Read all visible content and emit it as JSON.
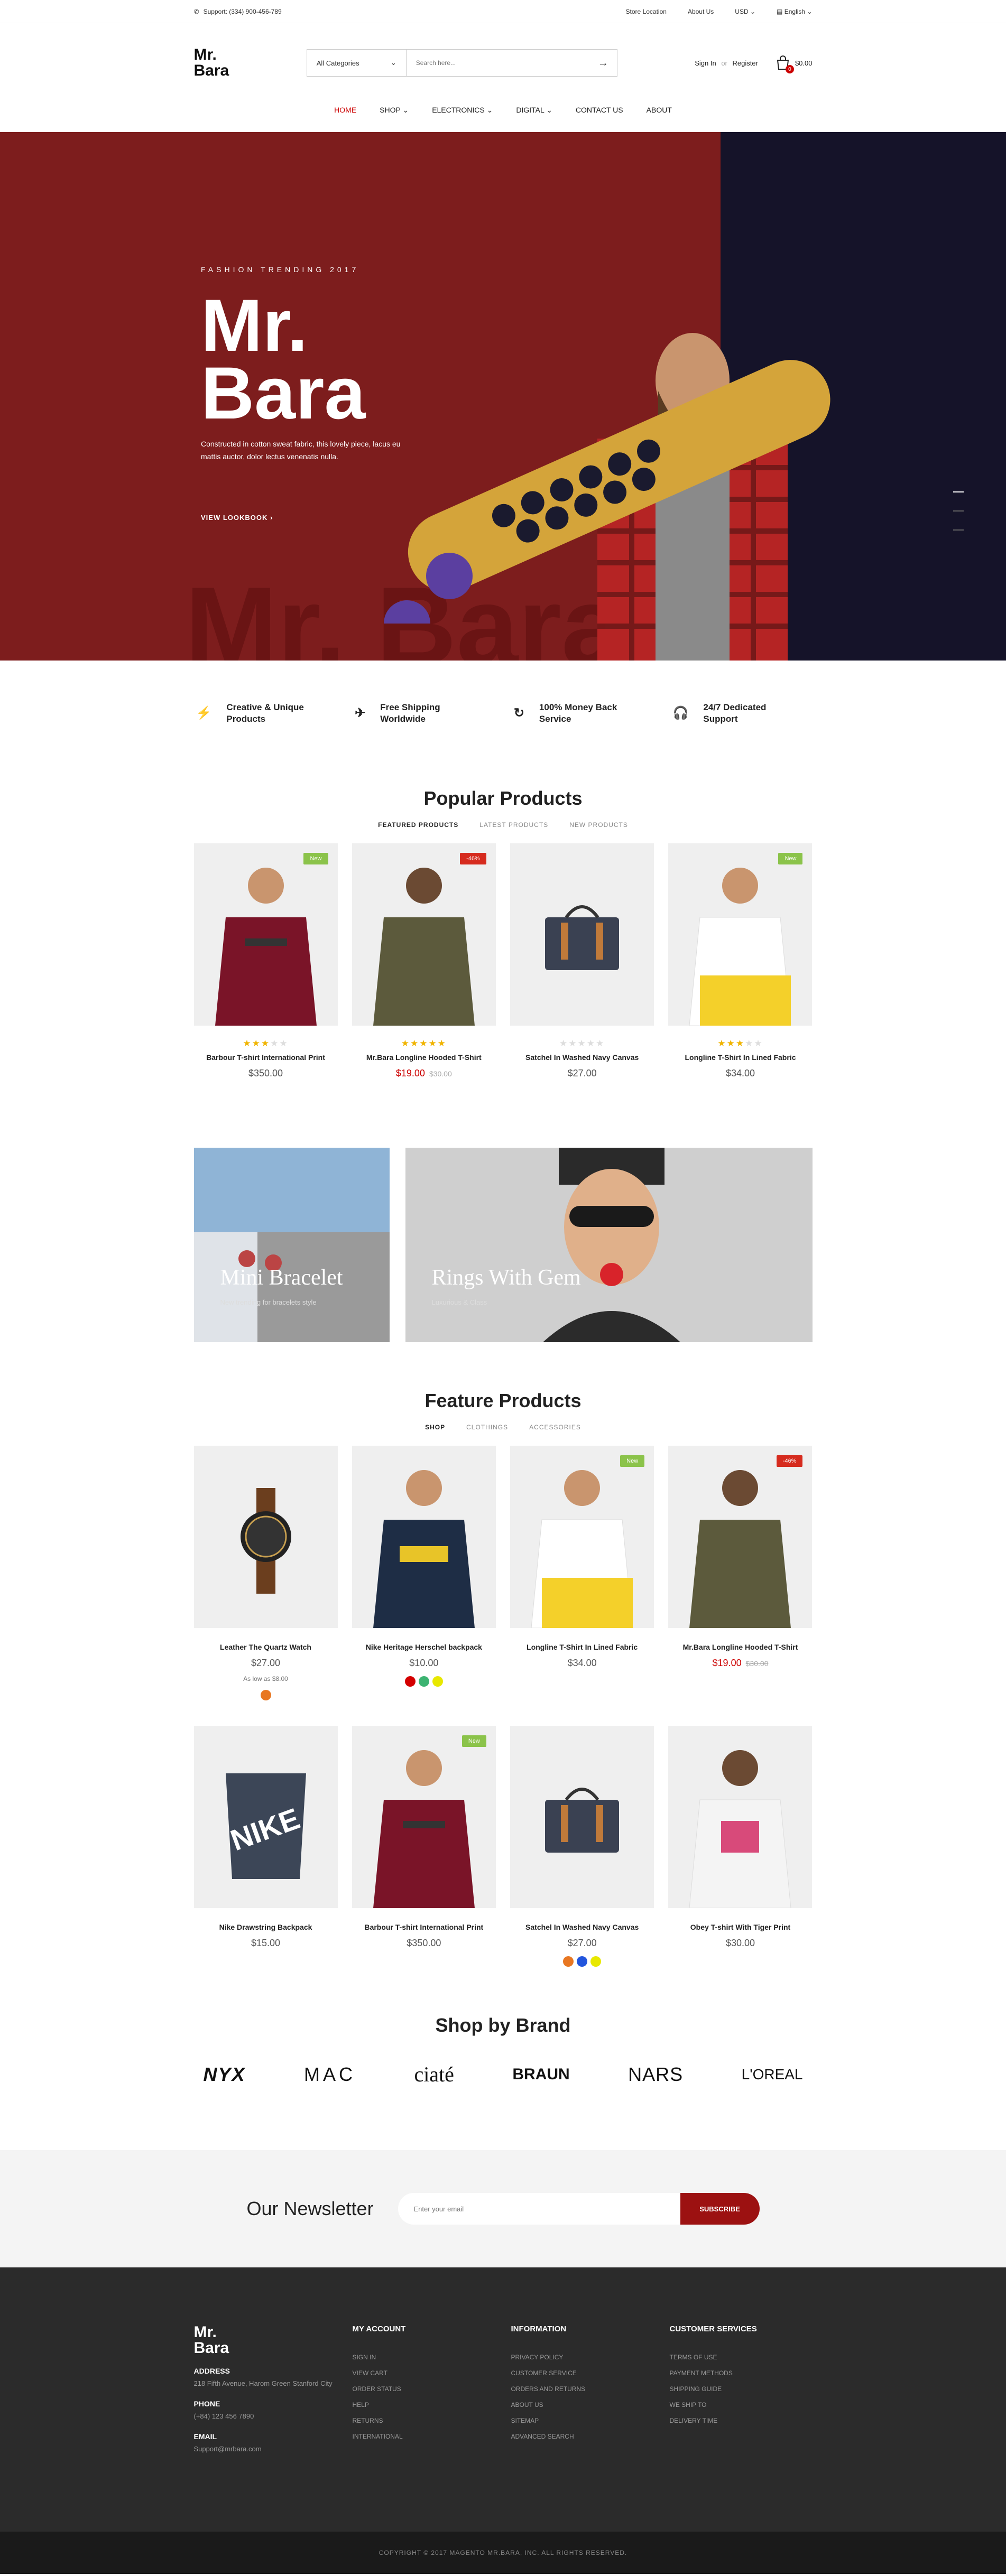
{
  "topbar": {
    "support": "Support: (334) 900-456-789",
    "store_location": "Store Location",
    "about_us": "About Us",
    "currency": "USD",
    "language": "English"
  },
  "header": {
    "logo": "Mr.\nBara",
    "category": "All Categories",
    "search_placeholder": "Search here...",
    "sign_in": "Sign In",
    "or": "or",
    "register": "Register",
    "cart_count": "0",
    "cart_total": "$0.00"
  },
  "nav": [
    "HOME",
    "SHOP",
    "ELECTRONICS",
    "DIGITAL",
    "CONTACT US",
    "ABOUT"
  ],
  "hero": {
    "trend": "FASHION TRENDING 2017",
    "title": "Mr.\nBara",
    "desc": "Constructed in cotton sweat fabric, this lovely piece, lacus eu mattis auctor, dolor lectus venenatis nulla.",
    "cta": "VIEW LOOKBOOK",
    "ghost": "Mr. Bara"
  },
  "features": [
    {
      "line1": "Creative & Unique",
      "line2": "Products"
    },
    {
      "line1": "Free Shipping",
      "line2": "Worldwide"
    },
    {
      "line1": "100% Money Back",
      "line2": "Service"
    },
    {
      "line1": "24/7 Dedicated",
      "line2": "Support"
    }
  ],
  "popular": {
    "title": "Popular Products",
    "tabs": [
      "FEATURED PRODUCTS",
      "LATEST PRODUCTS",
      "NEW PRODUCTS"
    ],
    "items": [
      {
        "name": "Barbour T-shirt International Print",
        "price": "$350.00",
        "rating": 3,
        "tag": "New"
      },
      {
        "name": "Mr.Bara Longline Hooded T-Shirt",
        "price": "$19.00",
        "old": "$30.00",
        "rating": 5,
        "tag": "-46%"
      },
      {
        "name": "Satchel In Washed Navy Canvas",
        "price": "$27.00",
        "rating": 0,
        "tag": ""
      },
      {
        "name": "Longline T-Shirt In Lined Fabric",
        "price": "$34.00",
        "rating": 3,
        "tag": "New"
      }
    ]
  },
  "banners": [
    {
      "title": "Mini Bracelet",
      "sub": "New trending for bracelets style"
    },
    {
      "title": "Rings With Gem",
      "sub": "Luxurious & Class"
    }
  ],
  "feature": {
    "title": "Feature Products",
    "tabs": [
      "SHOP",
      "CLOTHINGS",
      "ACCESSORIES"
    ],
    "row1": [
      {
        "name": "Leather The Quartz Watch",
        "price": "$27.00",
        "aslow": "As low as $8.00",
        "swatches": [
          "#e87722"
        ],
        "tag": ""
      },
      {
        "name": "Nike Heritage Herschel backpack",
        "price": "$10.00",
        "swatches": [
          "#d40000",
          "#3cb371",
          "#e8e800"
        ],
        "tag": ""
      },
      {
        "name": "Longline T-Shirt In Lined Fabric",
        "price": "$34.00",
        "tag": "New"
      },
      {
        "name": "Mr.Bara Longline Hooded T-Shirt",
        "price": "$19.00",
        "old": "$30.00",
        "tag": "-46%"
      }
    ],
    "row2": [
      {
        "name": "Nike Drawstring Backpack",
        "price": "$15.00",
        "tag": ""
      },
      {
        "name": "Barbour T-shirt International Print",
        "price": "$350.00",
        "tag": "New"
      },
      {
        "name": "Satchel In Washed Navy Canvas",
        "price": "$27.00",
        "swatches": [
          "#e87722",
          "#2255dd",
          "#e8e800"
        ],
        "tag": ""
      },
      {
        "name": "Obey T-shirt With Tiger Print",
        "price": "$30.00",
        "tag": ""
      }
    ]
  },
  "brands": {
    "title": "Shop by Brand",
    "list": [
      "NYX",
      "MAC",
      "ciaté",
      "BRAUN",
      "NARS",
      "L'OREAL"
    ]
  },
  "newsletter": {
    "title": "Our Newsletter",
    "placeholder": "Enter your email",
    "button": "SUBSCRIBE"
  },
  "footer": {
    "logo": "Mr.\nBara",
    "address_label": "ADDRESS",
    "address": "218 Fifth Avenue, Harom Green Stanford City",
    "phone_label": "PHONE",
    "phone": "(+84) 123 456 7890",
    "email_label": "EMAIL",
    "email": "Support@mrbara.com",
    "cols": [
      {
        "title": "MY ACCOUNT",
        "items": [
          "SIGN IN",
          "VIEW CART",
          "ORDER STATUS",
          "HELP",
          "RETURNS",
          "INTERNATIONAL"
        ]
      },
      {
        "title": "INFORMATION",
        "items": [
          "PRIVACY POLICY",
          "CUSTOMER SERVICE",
          "ORDERS AND RETURNS",
          "ABOUT US",
          "SITEMAP",
          "ADVANCED SEARCH"
        ]
      },
      {
        "title": "CUSTOMER SERVICES",
        "items": [
          "TERMS OF USE",
          "PAYMENT METHODS",
          "SHIPPING GUIDE",
          "WE SHIP TO",
          "DELIVERY TIME"
        ]
      }
    ],
    "copyright": "COPYRIGHT © 2017 MAGENTO MR.BARA, INC. ALL RIGHTS RESERVED."
  },
  "colors": {
    "accent": "#c00000",
    "hero_bg": "#7d1d1d",
    "hero_dark": "#151329",
    "footer_bg": "#2b2b2b",
    "badge_new": "#8bc34a",
    "badge_sale": "#d62b1e"
  }
}
